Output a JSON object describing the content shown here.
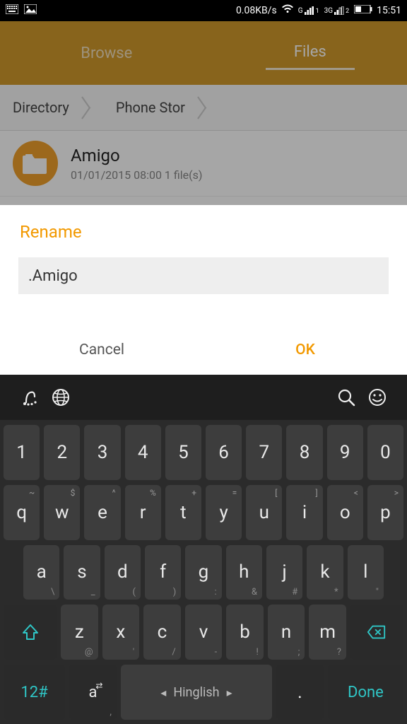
{
  "status": {
    "net_speed": "0.08KB/s",
    "sig1_label": "G",
    "sig2_label": "3G",
    "time": "15:51"
  },
  "app": {
    "tabs": {
      "browse": "Browse",
      "files": "Files"
    },
    "breadcrumbs": [
      "Directory",
      "Phone Stor"
    ],
    "item": {
      "name": "Amigo",
      "meta": "01/01/2015 08:00  1 file(s)"
    }
  },
  "dialog": {
    "title": "Rename",
    "input_value": ".Amigo",
    "cancel": "Cancel",
    "ok": "OK"
  },
  "keyboard": {
    "row_num": [
      "1",
      "2",
      "3",
      "4",
      "5",
      "6",
      "7",
      "8",
      "9",
      "0"
    ],
    "row_q": [
      {
        "m": "q",
        "s": "~"
      },
      {
        "m": "w",
        "s": "$"
      },
      {
        "m": "e",
        "s": "^"
      },
      {
        "m": "r",
        "s": "%"
      },
      {
        "m": "t",
        "s": "+"
      },
      {
        "m": "y",
        "s": "="
      },
      {
        "m": "u",
        "s": "["
      },
      {
        "m": "i",
        "s": "]"
      },
      {
        "m": "o",
        "s": "<"
      },
      {
        "m": "p",
        "s": ">"
      }
    ],
    "row_a": [
      {
        "m": "a",
        "b": "\\"
      },
      {
        "m": "s",
        "b": "_"
      },
      {
        "m": "d",
        "b": "("
      },
      {
        "m": "f",
        "b": ")"
      },
      {
        "m": "g",
        "b": ":"
      },
      {
        "m": "h",
        "b": "&"
      },
      {
        "m": "j",
        "b": "#"
      },
      {
        "m": "k",
        "b": "*"
      },
      {
        "m": "l",
        "b": "\""
      }
    ],
    "row_z": [
      {
        "m": "z",
        "b": "@"
      },
      {
        "m": "x",
        "b": "'"
      },
      {
        "m": "c",
        "b": "/"
      },
      {
        "m": "v",
        "b": "-"
      },
      {
        "m": "b",
        "b": "!"
      },
      {
        "m": "n",
        "b": ";"
      },
      {
        "m": "m",
        "b": "?"
      }
    ],
    "sym": "12#",
    "lang_key": "a",
    "lang_sub": ",",
    "space": "Hinglish",
    "dot": ".",
    "done": "Done"
  }
}
